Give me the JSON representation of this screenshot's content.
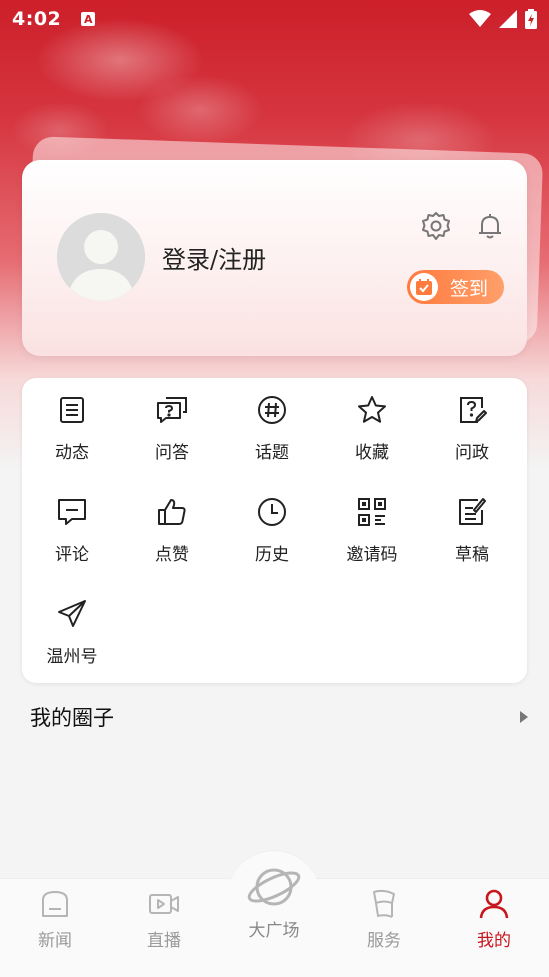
{
  "status_bar": {
    "time": "4:02",
    "notification_badge": "A"
  },
  "profile": {
    "login_label": "登录/注册",
    "checkin_label": "签到"
  },
  "menu": {
    "items": [
      {
        "label": "动态",
        "icon": "article-icon"
      },
      {
        "label": "问答",
        "icon": "qa-icon"
      },
      {
        "label": "话题",
        "icon": "hashtag-icon"
      },
      {
        "label": "收藏",
        "icon": "star-icon"
      },
      {
        "label": "问政",
        "icon": "question-edit-icon"
      },
      {
        "label": "评论",
        "icon": "comment-icon"
      },
      {
        "label": "点赞",
        "icon": "thumbs-up-icon"
      },
      {
        "label": "历史",
        "icon": "clock-icon"
      },
      {
        "label": "邀请码",
        "icon": "qr-code-icon"
      },
      {
        "label": "草稿",
        "icon": "draft-icon"
      },
      {
        "label": "温州号",
        "icon": "send-icon"
      }
    ]
  },
  "circles": {
    "title": "我的圈子"
  },
  "bottom_nav": {
    "items": [
      {
        "label": "新闻",
        "icon": "news-icon",
        "active": false
      },
      {
        "label": "直播",
        "icon": "video-icon",
        "active": false
      },
      {
        "label": "大广场",
        "icon": "planet-icon",
        "active": false
      },
      {
        "label": "服务",
        "icon": "flag-icon",
        "active": false
      },
      {
        "label": "我的",
        "icon": "user-icon",
        "active": true
      }
    ]
  },
  "colors": {
    "brand_red": "#cc1f2a",
    "active_tab": "#c8161e",
    "checkin_orange": "#ff7a3d",
    "inactive_tab": "#9a9a9a"
  }
}
